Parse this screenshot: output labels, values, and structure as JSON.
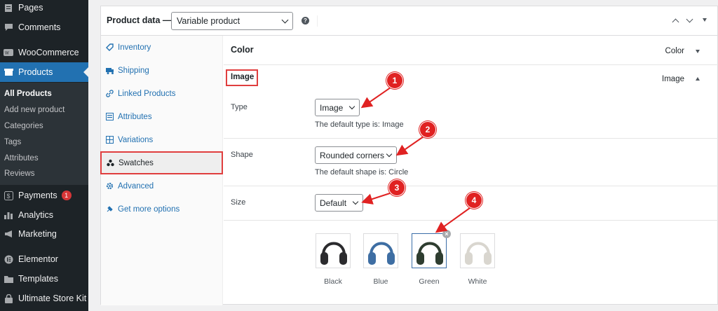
{
  "sidebar": {
    "pages": "Pages",
    "comments": "Comments",
    "woocommerce": "WooCommerce",
    "products": "Products",
    "submenu": [
      "All Products",
      "Add new product",
      "Categories",
      "Tags",
      "Attributes",
      "Reviews"
    ],
    "payments": "Payments",
    "payments_badge": "1",
    "analytics": "Analytics",
    "marketing": "Marketing",
    "elementor": "Elementor",
    "templates": "Templates",
    "ultimate_store_kit": "Ultimate Store Kit"
  },
  "header": {
    "title": "Product data —",
    "product_type": "Variable product",
    "help": "?"
  },
  "tabs": [
    "Inventory",
    "Shipping",
    "Linked Products",
    "Attributes",
    "Variations",
    "Swatches",
    "Advanced",
    "Get more options"
  ],
  "color_row": {
    "title": "Color",
    "right": "Color"
  },
  "image_row": {
    "title": "Image",
    "right": "Image"
  },
  "fields": {
    "type": {
      "label": "Type",
      "value": "Image",
      "hint": "The default type is: Image"
    },
    "shape": {
      "label": "Shape",
      "value": "Rounded corners",
      "hint": "The default shape is: Circle"
    },
    "size": {
      "label": "Size",
      "value": "Default"
    }
  },
  "swatches": [
    {
      "label": "Black",
      "color": "#2b2b2e"
    },
    {
      "label": "Blue",
      "color": "#3e6ea3"
    },
    {
      "label": "Green",
      "color": "#2e3d30"
    },
    {
      "label": "White",
      "color": "#d9d6cf"
    }
  ],
  "remove_glyph": "×",
  "markers": [
    "1",
    "2",
    "3",
    "4"
  ],
  "colors": {
    "accent": "#2271b1",
    "highlight": "#e03e3e",
    "sidebar": "#1d2327"
  }
}
